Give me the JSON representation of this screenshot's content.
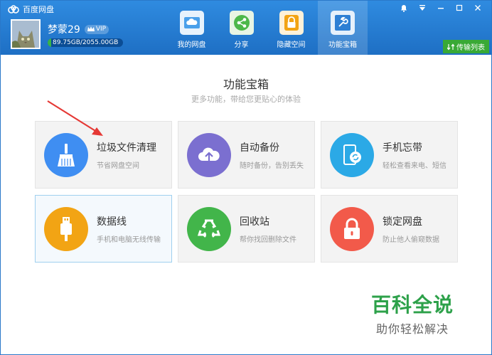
{
  "app": {
    "title": "百度网盘"
  },
  "window_controls": {
    "icons": [
      "bell-icon",
      "menu-icon",
      "minimize-icon",
      "maximize-icon",
      "close-icon"
    ]
  },
  "user": {
    "name": "梦蒙29",
    "vip_label": "VIP",
    "quota_text": "89.75GB/2055.00GB",
    "quota_fraction": 0.044
  },
  "nav": {
    "tabs": [
      {
        "label": "我的网盘",
        "icon": "cloud-icon"
      },
      {
        "label": "分享",
        "icon": "share-icon"
      },
      {
        "label": "隐藏空间",
        "icon": "lock-icon"
      },
      {
        "label": "功能宝箱",
        "icon": "tools-icon",
        "active": true
      }
    ]
  },
  "transfer_button": {
    "label": "传输列表"
  },
  "main": {
    "title": "功能宝箱",
    "subtitle": "更多功能，带给您更贴心的体验",
    "cards": [
      {
        "title": "垃圾文件清理",
        "desc": "节省网盘空间",
        "icon": "broom-icon",
        "color": "#3f8ef2"
      },
      {
        "title": "自动备份",
        "desc": "随时备份，告别丢失",
        "icon": "cloud-upload-icon",
        "color": "#7b6fd0"
      },
      {
        "title": "手机忘带",
        "desc": "轻松查看来电、短信",
        "icon": "phone-sync-icon",
        "color": "#2ba9e6"
      },
      {
        "title": "数据线",
        "desc": "手机和电脑无线传输",
        "icon": "usb-icon",
        "color": "#f2a414"
      },
      {
        "title": "回收站",
        "desc": "帮你找回删除文件",
        "icon": "recycle-icon",
        "color": "#42b54a"
      },
      {
        "title": "锁定网盘",
        "desc": "防止他人偷窥数据",
        "icon": "padlock-icon",
        "color": "#f25a4a"
      }
    ]
  },
  "watermark": {
    "line1": "百科全说",
    "line2": "助你轻松解决"
  }
}
